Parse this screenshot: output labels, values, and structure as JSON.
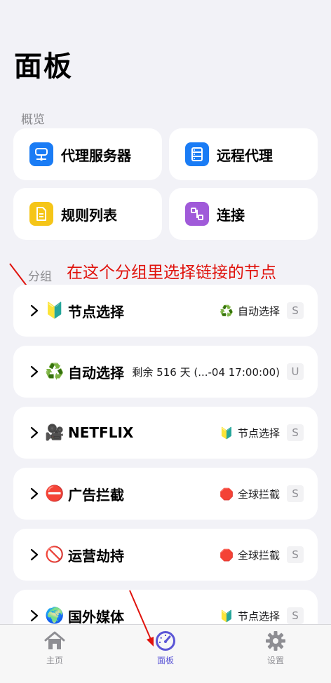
{
  "page": {
    "title": "面板"
  },
  "overview": {
    "label": "概览",
    "tiles": [
      {
        "label": "代理服务器",
        "icon": "server-icon",
        "color": "#1a7cf5"
      },
      {
        "label": "远程代理",
        "icon": "remote-list-icon",
        "color": "#1a7cf5"
      },
      {
        "label": "规则列表",
        "icon": "document-icon",
        "color": "#f5c518"
      },
      {
        "label": "连接",
        "icon": "connection-icon",
        "color": "#a05ad9"
      }
    ]
  },
  "groups": {
    "label": "分组",
    "annotation": "在这个分组里选择链接的节点",
    "items": [
      {
        "emoji": "🔰",
        "name": "节点选择",
        "selected_emoji": "♻️",
        "selected": "自动选择",
        "badge": "S"
      },
      {
        "emoji": "♻️",
        "name": "自动选择",
        "selected_emoji": "",
        "selected": "剩余 516 天 (...-04 17:00:00)",
        "badge": "U"
      },
      {
        "emoji": "🎥",
        "name": "NETFLIX",
        "selected_emoji": "🔰",
        "selected": "节点选择",
        "badge": "S"
      },
      {
        "emoji": "⛔",
        "name": "广告拦截",
        "selected_emoji": "🛑",
        "selected": "全球拦截",
        "badge": "S"
      },
      {
        "emoji": "🚫",
        "name": "运营劫持",
        "selected_emoji": "🛑",
        "selected": "全球拦截",
        "badge": "S"
      },
      {
        "emoji": "🌍",
        "name": "国外媒体",
        "selected_emoji": "🔰",
        "selected": "节点选择",
        "badge": "S"
      }
    ]
  },
  "tabbar": {
    "tabs": [
      {
        "label": "主页",
        "icon": "home-icon",
        "active": false
      },
      {
        "label": "面板",
        "icon": "dashboard-gauge-icon",
        "active": true
      },
      {
        "label": "设置",
        "icon": "gear-icon",
        "active": false
      }
    ],
    "active_color": "#5b56d6"
  }
}
